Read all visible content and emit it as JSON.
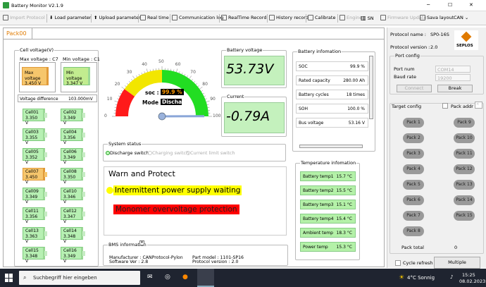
{
  "window": {
    "title": "Battery Monitor V2.1.9",
    "minimize": "─",
    "maximize": "☐",
    "close": "✕"
  },
  "toolbar": {
    "import": "Import Protocol",
    "load": "Load parameter",
    "upload": "Upload parameter",
    "realtime": "Real time",
    "comm_log": "Communication log",
    "rt_record": "RealTime Record",
    "history": "History record",
    "calibrate": "Calibrate",
    "engine": "Engine",
    "sn": "SN",
    "firmware": "Firmware Update",
    "save_layout": "Sava layout",
    "can": "CAN"
  },
  "tab": {
    "label": "Pack00"
  },
  "cell_voltage": {
    "title": "Cell voltage(V)",
    "max_label": "Max voltage : C7",
    "min_label": "Min voltage : C1",
    "max_box_label": "Max voltage",
    "max_value": "3.450 V",
    "min_box_label": "Min voltage",
    "min_value": "3.347 V",
    "diff_label": "Voltage difference",
    "diff_value": "103.000mV",
    "cells": [
      {
        "name": "Cell01",
        "value": "3.350 V"
      },
      {
        "name": "Cell02",
        "value": "3.349 V"
      },
      {
        "name": "Cell03",
        "value": "3.355 V"
      },
      {
        "name": "Cell04",
        "value": "3.356 V"
      },
      {
        "name": "Cell05",
        "value": "3.352 V"
      },
      {
        "name": "Cell06",
        "value": "3.349 V"
      },
      {
        "name": "Cell07",
        "value": "3.450 V"
      },
      {
        "name": "Cell08",
        "value": "3.350 V"
      },
      {
        "name": "Cell09",
        "value": "3.349 V"
      },
      {
        "name": "Cell10",
        "value": "3.346 V"
      },
      {
        "name": "Cell11",
        "value": "3.356 V"
      },
      {
        "name": "Cell12",
        "value": "3.347 V"
      },
      {
        "name": "Cell13",
        "value": "3.363 V"
      },
      {
        "name": "Cell14",
        "value": "3.348 V"
      },
      {
        "name": "Cell15",
        "value": "3.348 V"
      },
      {
        "name": "Cell16",
        "value": "3.349 V"
      }
    ]
  },
  "gauge": {
    "ticks": [
      "0",
      "10",
      "20",
      "30",
      "40",
      "50",
      "60",
      "70",
      "80",
      "90",
      "100"
    ],
    "soc_label": "soc :",
    "soc_value": "99.9 %",
    "mode_label": "Mode :",
    "mode_value": "Discharge",
    "soc_fraction": 0.999
  },
  "battery_voltage": {
    "title": "Battery voltage",
    "value": "53.73V"
  },
  "current": {
    "title": "Current",
    "value": "-0.79A"
  },
  "battery_info": {
    "title": "Battery infomation",
    "rows": [
      {
        "label": "SOC",
        "value": "99.9 %"
      },
      {
        "label": "Rated capacity",
        "value": "280.00 Ah"
      },
      {
        "label": "Battery cycles",
        "value": "18 times"
      },
      {
        "label": "SOH",
        "value": "100.0 %"
      },
      {
        "label": "Bus voltage",
        "value": "53.16 V"
      }
    ]
  },
  "system_status": {
    "title": "System status",
    "discharge": "Discharge switch",
    "charging": "Charging switch",
    "current_limit": "Current limit switch"
  },
  "warn": {
    "title": "Warn and Protect",
    "warning": "Intermittent power supply waiting",
    "protection": "Monomer overvoltage protection"
  },
  "temperature": {
    "title": "Temperature infomation",
    "rows": [
      {
        "label": "Battery temp1",
        "value": "15.7 °C"
      },
      {
        "label": "Battery temp2",
        "value": "15.5 °C"
      },
      {
        "label": "Battery temp3",
        "value": "15.1 °C"
      },
      {
        "label": "Battery temp4",
        "value": "15.4 °C"
      },
      {
        "label": "Ambient temp",
        "value": "18.3 °C"
      },
      {
        "label": "Power temp",
        "value": "15.3 °C"
      }
    ]
  },
  "bms": {
    "title": "BMS information",
    "manufacturer": "Manufacturer :  CANProtocol-Pylon",
    "software": "Software Ver :  2.8",
    "part_model": "Part model :     1101-SP16",
    "protocol_version": "Protocol version : 2.0"
  },
  "right": {
    "protocol_name_label": "Protocol name :",
    "protocol_name_value": "SP0-16S",
    "protocol_version_label": "Protocol version :",
    "protocol_version_value": "2.0",
    "logo_text": "SEPLOS",
    "port_config": "Port config",
    "port_num_label": "Port num",
    "port_num_value": "COM14",
    "baud_label": "Baud rate",
    "baud_value": "19200",
    "connect": "Connect",
    "break": "Break",
    "target_config": "Target config",
    "pack_addr": "Pack addr",
    "packs": [
      "Pack 1",
      "Pack 9",
      "Pack 2",
      "Pack 10",
      "Pack 3",
      "Pack 11",
      "Pack 4",
      "Pack 12",
      "Pack 5",
      "Pack 13",
      "Pack 6",
      "Pack 14",
      "Pack 7",
      "Pack 15",
      "Pack 8"
    ],
    "pack_total_label": "Pack total",
    "pack_total_value": "0",
    "cycle_refresh": "Cycle refresh",
    "multiple": "Multiple"
  },
  "taskbar": {
    "search": "Suchbegriff hier eingeben",
    "weather": "4°C  Sonnig",
    "time": "15:25",
    "date": "08.02.2023"
  },
  "colors": {
    "green": "#b7f0b3",
    "warn_orange": "#f6c66c",
    "accent": "#e07a00",
    "yellow": "#ffff00",
    "red": "#ff0000"
  }
}
